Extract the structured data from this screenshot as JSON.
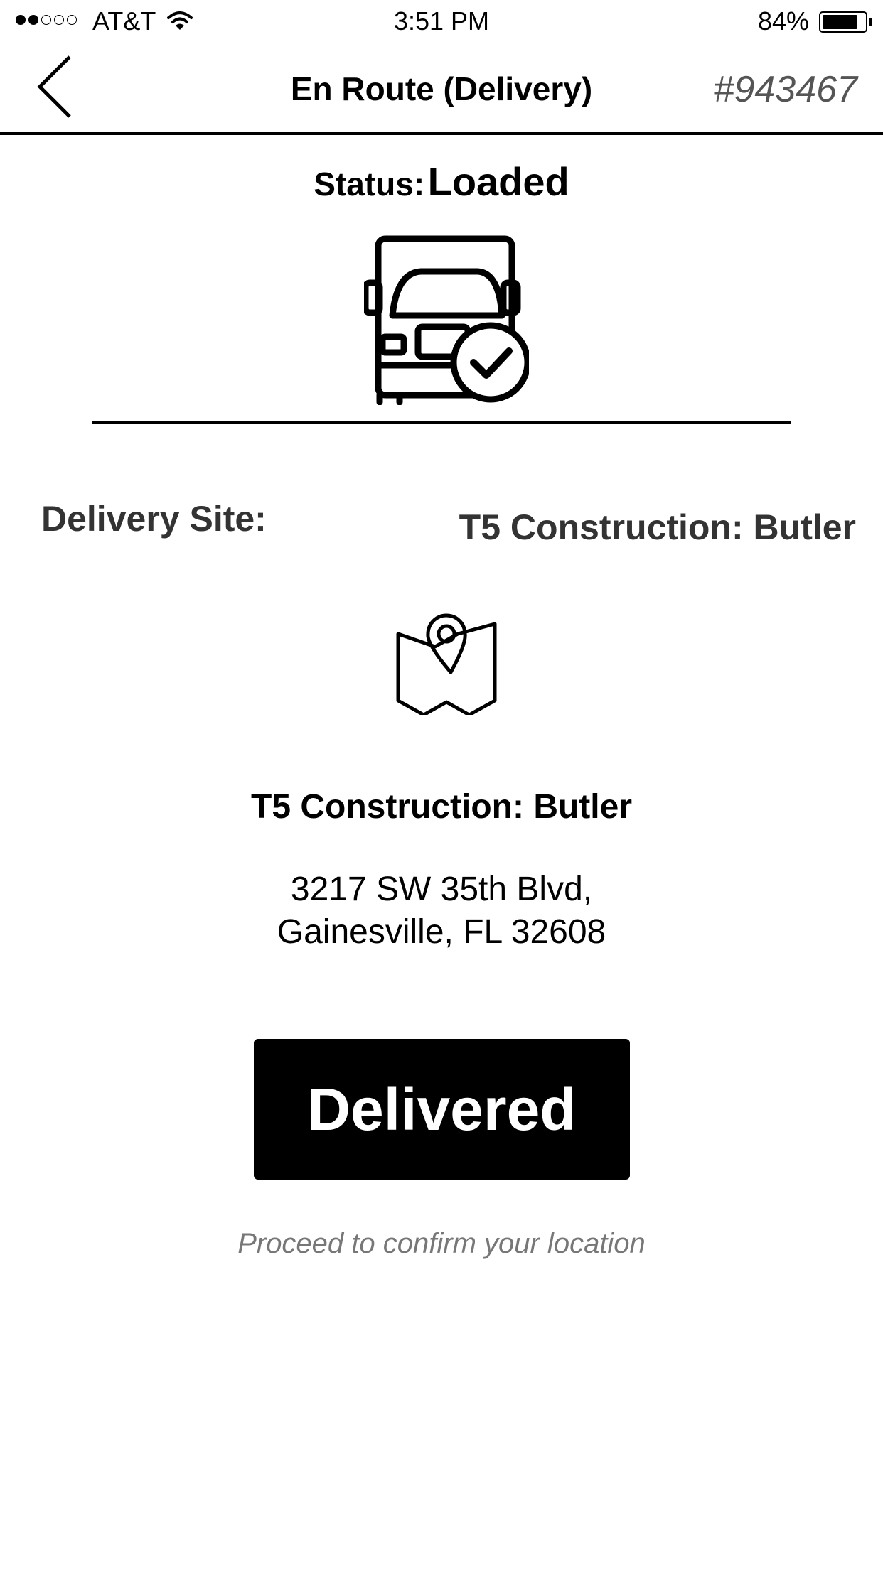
{
  "status_bar": {
    "carrier": "AT&T",
    "time": "3:51 PM",
    "battery_percent": "84%",
    "battery_level": 0.84,
    "signal_bars_filled": 2,
    "signal_bars_total": 5
  },
  "nav": {
    "back_icon": "chevron-left-icon",
    "title": "En Route (Delivery)",
    "order_number": "#943467"
  },
  "status": {
    "label": "Status:",
    "value": "Loaded",
    "icon": "truck-check-icon"
  },
  "delivery": {
    "site_label": "Delivery Site:",
    "site_value": "T5 Construction: Butler",
    "map_icon": "map-pin-icon",
    "site_name": "T5 Construction: Butler",
    "address_line1": "3217 SW 35th Blvd,",
    "address_line2": "Gainesville, FL 32608"
  },
  "actions": {
    "delivered_label": "Delivered",
    "hint": "Proceed to confirm your location"
  },
  "colors": {
    "primary": "#000000",
    "background": "#ffffff",
    "secondary_text": "#777777"
  }
}
